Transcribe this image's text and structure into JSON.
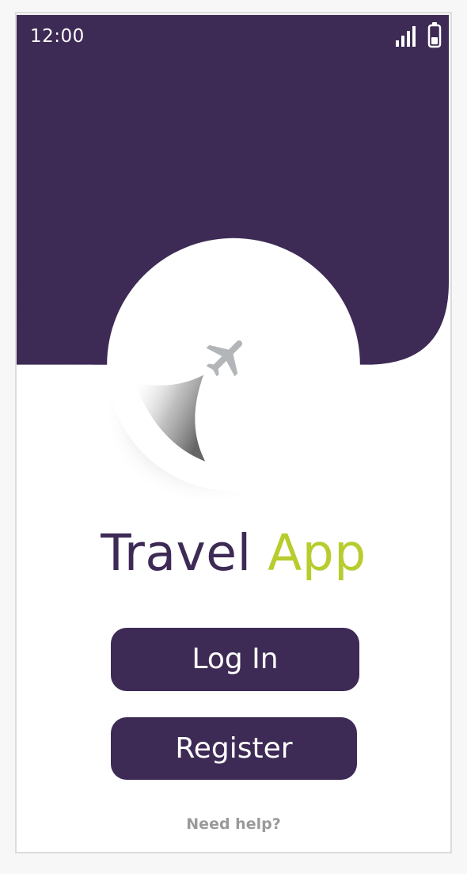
{
  "status_bar": {
    "time": "12:00",
    "signal_icon": "signal-bars-icon",
    "battery_icon": "battery-icon"
  },
  "hero": {
    "logo_icon": "airplane-icon"
  },
  "title": {
    "word_1": "Travel",
    "word_2": "App"
  },
  "buttons": {
    "login_label": "Log In",
    "register_label": "Register"
  },
  "footer": {
    "help_label": "Need help?"
  },
  "colors": {
    "primary": "#3d2a55",
    "accent": "#b8cc2e",
    "muted_text": "#9a9a9a",
    "icon_gray": "#b3b6b8"
  }
}
